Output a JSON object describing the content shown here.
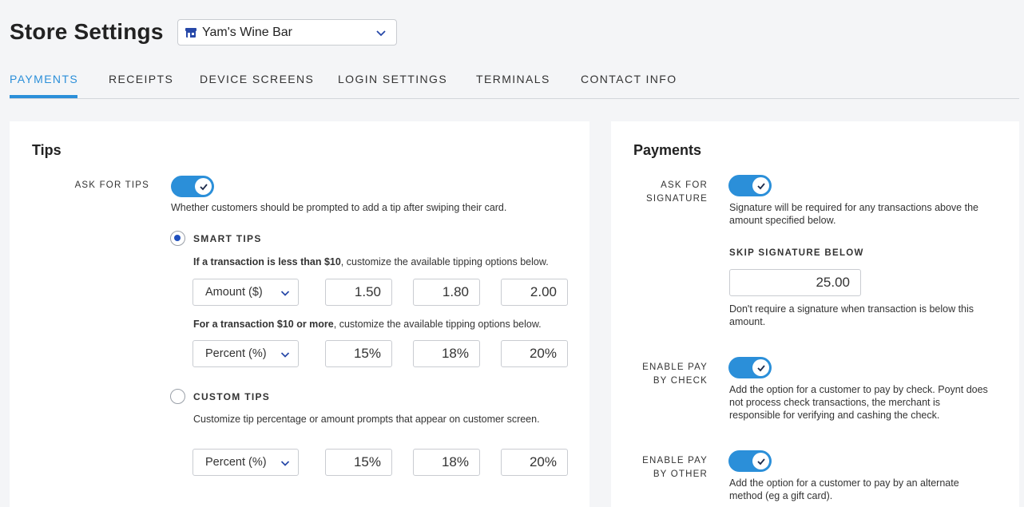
{
  "header": {
    "title": "Store Settings",
    "store_select": {
      "value": "Yam's Wine Bar",
      "icon": "store-icon"
    }
  },
  "tabs": [
    {
      "label": "PAYMENTS",
      "active": true
    },
    {
      "label": "RECEIPTS"
    },
    {
      "label": "DEVICE SCREENS"
    },
    {
      "label": "LOGIN SETTINGS"
    },
    {
      "label": "TERMINALS"
    },
    {
      "label": "CONTACT INFO"
    }
  ],
  "colors": {
    "accent": "#2b8fd9",
    "radio": "#1f4fbd"
  },
  "tips": {
    "title": "Tips",
    "ask_label": "ASK FOR TIPS",
    "ask_enabled": true,
    "ask_help": "Whether customers should be prompted to add a tip after swiping their card.",
    "smart": {
      "label": "SMART TIPS",
      "selected": true,
      "under_help_bold": "If a transaction is less than $10",
      "under_help_rest": ", customize the available tipping options below.",
      "under_type": "Amount ($)",
      "under_values": [
        "1.50",
        "1.80",
        "2.00"
      ],
      "over_help_bold": "For a transaction $10 or more",
      "over_help_rest": ", customize the available tipping options below.",
      "over_type": "Percent (%)",
      "over_values": [
        "15%",
        "18%",
        "20%"
      ]
    },
    "custom": {
      "label": "CUSTOM TIPS",
      "selected": false,
      "help": "Customize tip percentage or amount prompts that appear on customer screen.",
      "type": "Percent (%)",
      "values": [
        "15%",
        "18%",
        "20%"
      ]
    }
  },
  "payments": {
    "title": "Payments",
    "signature": {
      "label_line1": "ASK FOR",
      "label_line2": "SIGNATURE",
      "enabled": true,
      "help": "Signature will be required for any transactions above the amount specified below.",
      "skip_label": "SKIP SIGNATURE BELOW",
      "skip_value": "25.00",
      "skip_help": "Don't require a signature when transaction is below this amount."
    },
    "check": {
      "label_line1": "ENABLE PAY",
      "label_line2": "BY CHECK",
      "enabled": true,
      "help": "Add the option for a customer to pay by check. Poynt does not process check transactions, the merchant is responsible for verifying and cashing the check."
    },
    "other": {
      "label_line1": "ENABLE PAY",
      "label_line2": "BY OTHER",
      "enabled": true,
      "help": "Add the option for a customer to pay by an alternate method (eg a gift card)."
    }
  }
}
